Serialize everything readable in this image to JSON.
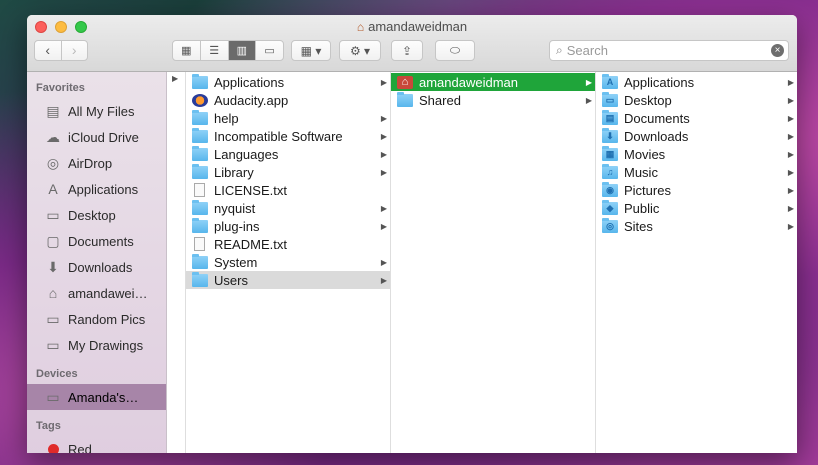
{
  "window": {
    "title": "amandaweidman"
  },
  "toolbar": {
    "back": "‹",
    "forward": "›",
    "views": [
      "▦",
      "☰",
      "▥",
      "▭"
    ],
    "arrange": "▦ ▾",
    "action": "⚙ ▾",
    "share": "⇪",
    "tag": "⬭",
    "search_placeholder": "Search"
  },
  "sidebar": {
    "favorites_header": "Favorites",
    "favorites": [
      {
        "label": "All My Files",
        "icon": "all-files-icon",
        "glyph": "▤"
      },
      {
        "label": "iCloud Drive",
        "icon": "cloud-icon",
        "glyph": "☁"
      },
      {
        "label": "AirDrop",
        "icon": "airdrop-icon",
        "glyph": "◎"
      },
      {
        "label": "Applications",
        "icon": "applications-icon",
        "glyph": "A"
      },
      {
        "label": "Desktop",
        "icon": "desktop-icon",
        "glyph": "▭"
      },
      {
        "label": "Documents",
        "icon": "documents-icon",
        "glyph": "▢"
      },
      {
        "label": "Downloads",
        "icon": "downloads-icon",
        "glyph": "⬇"
      },
      {
        "label": "amandawei…",
        "icon": "home-icon",
        "glyph": "⌂"
      },
      {
        "label": "Random Pics",
        "icon": "folder-icon",
        "glyph": "▭"
      },
      {
        "label": "My Drawings",
        "icon": "folder-icon",
        "glyph": "▭"
      }
    ],
    "devices_header": "Devices",
    "devices": [
      {
        "label": "Amanda's…",
        "icon": "laptop-icon",
        "glyph": "▭"
      }
    ],
    "tags_header": "Tags",
    "tags": [
      {
        "label": "Red",
        "color": "#e02a2a"
      }
    ]
  },
  "column1": [
    {
      "name": "Applications",
      "type": "app-folder",
      "arrow": true
    },
    {
      "name": "Audacity.app",
      "type": "audacity",
      "arrow": false
    },
    {
      "name": "help",
      "type": "folder",
      "arrow": true
    },
    {
      "name": "Incompatible Software",
      "type": "folder",
      "arrow": true
    },
    {
      "name": "Languages",
      "type": "folder",
      "arrow": true
    },
    {
      "name": "Library",
      "type": "folder",
      "arrow": true
    },
    {
      "name": "LICENSE.txt",
      "type": "doc",
      "arrow": false
    },
    {
      "name": "nyquist",
      "type": "folder",
      "arrow": true
    },
    {
      "name": "plug-ins",
      "type": "folder",
      "arrow": true
    },
    {
      "name": "README.txt",
      "type": "doc",
      "arrow": false
    },
    {
      "name": "System",
      "type": "system",
      "arrow": true
    },
    {
      "name": "Users",
      "type": "users",
      "arrow": true,
      "selected": true
    }
  ],
  "column2": [
    {
      "name": "amandaweidman",
      "type": "home",
      "arrow": true,
      "selected": true
    },
    {
      "name": "Shared",
      "type": "folder",
      "arrow": true
    }
  ],
  "column3": [
    {
      "name": "Applications",
      "glyph": "A"
    },
    {
      "name": "Desktop",
      "glyph": "▭"
    },
    {
      "name": "Documents",
      "glyph": "▤"
    },
    {
      "name": "Downloads",
      "glyph": "⬇"
    },
    {
      "name": "Movies",
      "glyph": "▦"
    },
    {
      "name": "Music",
      "glyph": "♫"
    },
    {
      "name": "Pictures",
      "glyph": "◉"
    },
    {
      "name": "Public",
      "glyph": "◆"
    },
    {
      "name": "Sites",
      "glyph": "◎"
    }
  ],
  "colors": {
    "selection_green": "#1fa53a",
    "sidebar_selected": "#a785a8",
    "folder_blue": "#58b6ec"
  }
}
